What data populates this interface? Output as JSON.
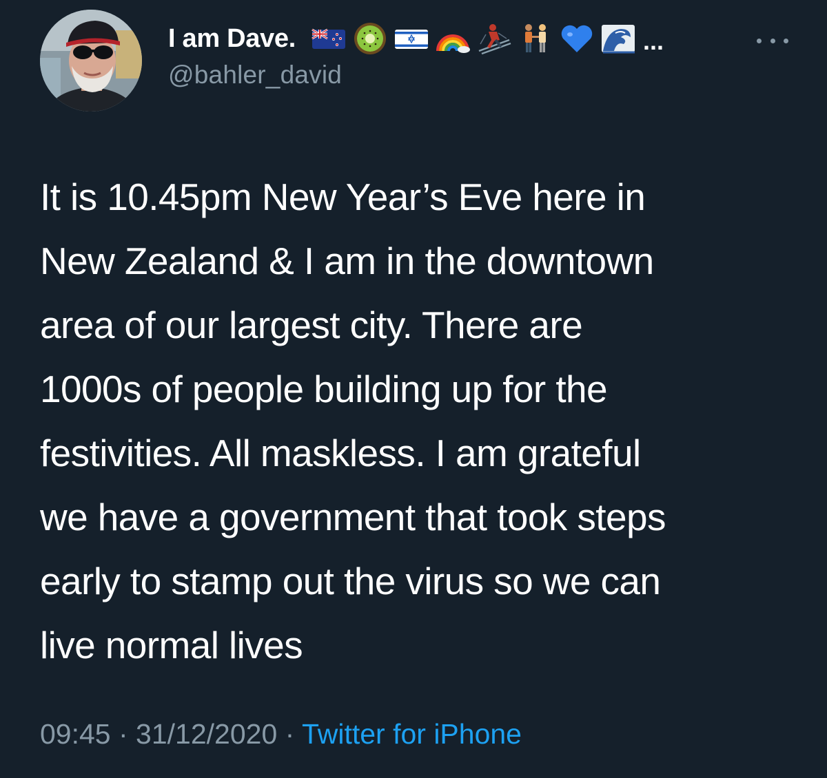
{
  "author": {
    "display_name": "I am Dave.",
    "handle": "@bahler_david",
    "name_emojis": [
      "new-zealand-flag-icon",
      "kiwi-fruit-icon",
      "israel-flag-icon",
      "rainbow-icon",
      "skier-icon",
      "two-men-holding-hands-icon",
      "blue-heart-icon",
      "water-wave-icon"
    ],
    "truncation": "..."
  },
  "tweet": {
    "lines": [
      "It is 10.45pm New Year’s Eve here in",
      "New Zealand & I am in the downtown",
      "area of our largest city. There are",
      "1000s of people building up for the",
      "festivities. All maskless. I am grateful",
      "we have a government that took steps",
      "early to stamp out the virus so we can",
      "live normal lives"
    ]
  },
  "meta": {
    "time": "09:45",
    "separator": " · ",
    "date": "31/12/2020",
    "source": "Twitter for iPhone"
  },
  "colors": {
    "background": "#15202b",
    "text_primary": "#ffffff",
    "text_secondary": "#8899a6",
    "link": "#1da1f2"
  }
}
